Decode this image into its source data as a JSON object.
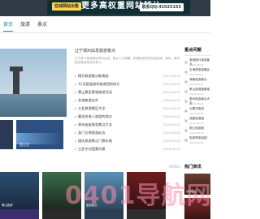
{
  "top_banner": {
    "tag": "在线网站出售",
    "headline": "更多高权重网站转让",
    "contact": "联系QQ:41025153"
  },
  "nav": {
    "items": [
      {
        "label": "首页",
        "active": true
      },
      {
        "label": "旅游",
        "active": false
      },
      {
        "label": "景点",
        "active": false
      }
    ]
  },
  "hero": {
    "image": "lake-pagoda-image",
    "thumbs": [
      {
        "caption": ""
      },
      {
        "caption": "西江月"
      }
    ]
  },
  "news": {
    "heading": "辽宁郑州出发旅游景点",
    "desc": "辽宁首个旅游景区郑州出发。新乡人口规模、所需旅游项目包括参观、游玩。联系相关旅游项目负责人。",
    "items": [
      {
        "title": "揭开旅游景点新奥秘",
        "date": "2024-08-02"
      },
      {
        "title": "11月首届游学旅游团的地方",
        "date": "2024-08-02"
      },
      {
        "title": "黄山景区景观旅游活动",
        "date": "2024-08-02"
      },
      {
        "title": "北海旅游去外",
        "date": "2024-08-02"
      },
      {
        "title": "三亚旅游景区大全",
        "date": "2024-08-02"
      },
      {
        "title": "最适合老人旅游的地方",
        "date": "2024-08-02"
      },
      {
        "title": "郑州出省旅游景点大全",
        "date": "2024-08-02"
      },
      {
        "title": "浙门古巷旅游必去",
        "date": "2024-08-02"
      },
      {
        "title": "国庆旅游景点门票价格",
        "date": "2024-08-02"
      },
      {
        "title": "三亚才对国景风景",
        "date": "2024-08-02"
      }
    ]
  },
  "hot_sidebar": {
    "title": "重点问题",
    "items": [
      {
        "index": "1",
        "text": "参观旅行旅游景点",
        "date": "2024-08-02"
      },
      {
        "index": "2",
        "text": "五海林旅游景区",
        "date": "2024-08-02"
      },
      {
        "index": "3",
        "text": "海南旅游景点",
        "date": "2024-08-02"
      },
      {
        "index": "4",
        "text": "泰山旅游团景观",
        "date": "2024-08-02"
      },
      {
        "index": "5",
        "text": "泰州旅游景点大全",
        "date": "2024-08-02"
      },
      {
        "index": "6",
        "text": "九寨沟旅游",
        "date": "2024-08-02"
      },
      {
        "index": "7",
        "text": "成都旅游团",
        "date": "2024-08-02"
      },
      {
        "index": "8",
        "text": "丽江旅游团",
        "date": "2024-08-02"
      },
      {
        "index": "9",
        "text": "张家界旅游团",
        "date": "2024-08-02"
      }
    ]
  },
  "section_right": {
    "more": "MORE+",
    "title": "热门资讯"
  },
  "gallery": {
    "tiles": [
      {
        "caption": "黄山旅游"
      },
      {
        "caption": ""
      },
      {
        "caption": "旅游景点"
      },
      {
        "caption": ""
      }
    ]
  },
  "right_bottom": {
    "cap1": "旅游路线",
    "cap2": ""
  },
  "watermark": {
    "text": "0401导航网"
  }
}
